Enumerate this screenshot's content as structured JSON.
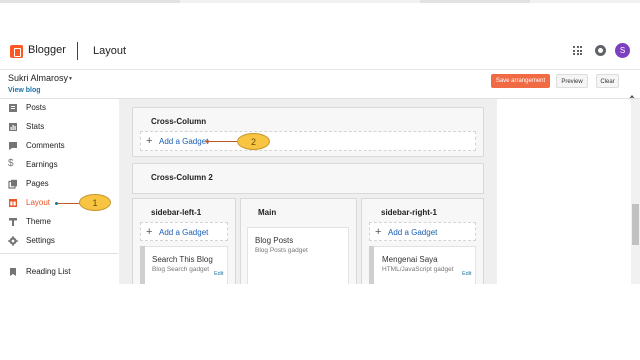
{
  "app": {
    "brand": "Blogger",
    "section": "Layout",
    "avatar_initial": "S",
    "brand_color": "#ff5722",
    "avatar_color": "#7b3fbf"
  },
  "blog": {
    "name": "Sukri Almarosy",
    "view_link": "View blog"
  },
  "toolbar": {
    "save_label": "Save arrangement",
    "preview_label": "Preview",
    "clear_label": "Clear",
    "save_color": "#f06a44"
  },
  "sidebar": {
    "items": [
      {
        "label": "Posts",
        "icon": "posts-icon",
        "active": false
      },
      {
        "label": "Stats",
        "icon": "stats-icon",
        "active": false
      },
      {
        "label": "Comments",
        "icon": "comments-icon",
        "active": false
      },
      {
        "label": "Earnings",
        "icon": "earnings-icon",
        "active": false
      },
      {
        "label": "Pages",
        "icon": "pages-icon",
        "active": false
      },
      {
        "label": "Layout",
        "icon": "layout-icon",
        "active": true
      },
      {
        "label": "Theme",
        "icon": "theme-icon",
        "active": false
      },
      {
        "label": "Settings",
        "icon": "settings-icon",
        "active": false
      }
    ],
    "reading_list": {
      "label": "Reading List",
      "icon": "bookmark-icon"
    },
    "active_color": "#e8562a"
  },
  "layout": {
    "cross_column": {
      "title": "Cross-Column",
      "add_label": "Add a Gadget"
    },
    "cross_column_2": {
      "title": "Cross-Column 2"
    },
    "sidebar_left": {
      "title": "sidebar-left-1",
      "add_label": "Add a Gadget",
      "gadget": {
        "title": "Search This Blog",
        "subtitle": "Blog Search gadget",
        "edit": "Edit"
      }
    },
    "main": {
      "title": "Main",
      "gadget": {
        "title": "Blog Posts",
        "subtitle": "Blog Posts gadget"
      }
    },
    "sidebar_right": {
      "title": "sidebar-right-1",
      "add_label": "Add a Gadget",
      "gadget": {
        "title": "Mengenai Saya",
        "subtitle": "HTML/JavaScript gadget",
        "edit": "Edit"
      }
    }
  },
  "callouts": [
    {
      "number": "1"
    },
    {
      "number": "2"
    }
  ]
}
